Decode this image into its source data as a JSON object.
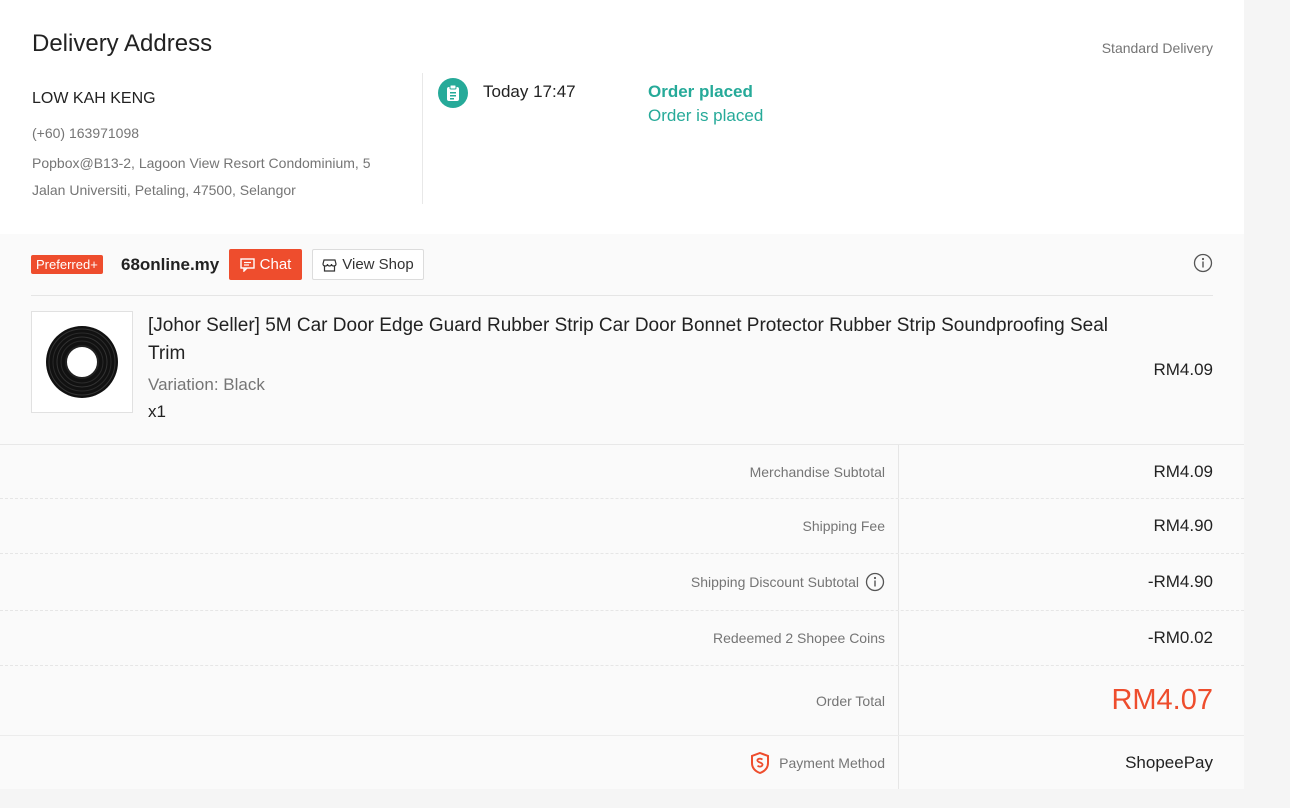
{
  "address": {
    "title": "Delivery Address",
    "delivery_type": "Standard Delivery",
    "name": "LOW KAH KENG",
    "phone": "(+60) 163971098",
    "line": "Popbox@B13-2, Lagoon View Resort Condominium, 5 Jalan Universiti, Petaling, 47500, Selangor"
  },
  "tracking": {
    "time": "Today 17:47",
    "status": "Order placed",
    "description": "Order is placed",
    "icon": "clipboard-icon"
  },
  "shop": {
    "badge": "Preferred+",
    "name": "68online.my",
    "chat_label": "Chat",
    "view_shop_label": "View Shop"
  },
  "product": {
    "name": "[Johor Seller] 5M Car Door Edge Guard Rubber Strip Car Door Bonnet Protector Rubber Strip Soundproofing Seal Trim",
    "variation": "Variation: Black",
    "quantity": "x1",
    "price": "RM4.09"
  },
  "summary": {
    "merchandise_label": "Merchandise Subtotal",
    "merchandise_value": "RM4.09",
    "shipping_label": "Shipping Fee",
    "shipping_value": "RM4.90",
    "ship_discount_label": "Shipping Discount Subtotal",
    "ship_discount_value": "-RM4.90",
    "coins_label": "Redeemed 2 Shopee Coins",
    "coins_value": "-RM0.02",
    "total_label": "Order Total",
    "total_value": "RM4.07"
  },
  "payment": {
    "label": "Payment Method",
    "value": "ShopeePay"
  },
  "colors": {
    "brand": "#ee4d2d",
    "teal": "#26aa99"
  }
}
